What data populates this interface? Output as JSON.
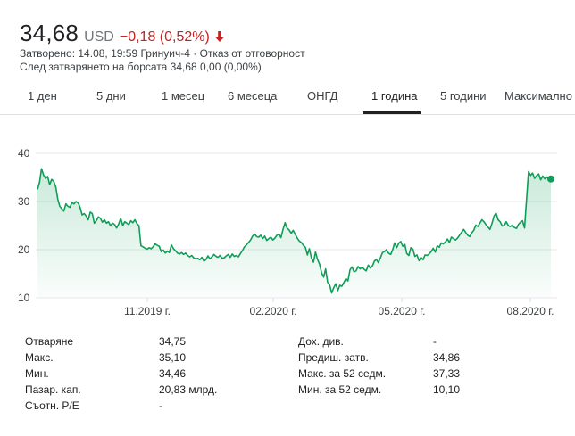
{
  "header": {
    "price": "34,68",
    "currency": "USD",
    "change": "−0,18 (0,52%)",
    "change_color": "#c5221f",
    "direction_icon": "arrow-down-icon",
    "meta_line1": "Затворено: 14.08, 19:59 Гринуич-4 · Отказ от отговорност",
    "meta_line2": "След затварянето на борсата 34,68 0,00 (0,00%)"
  },
  "tabs": [
    {
      "label": "1 ден"
    },
    {
      "label": "5 дни"
    },
    {
      "label": "1 месец"
    },
    {
      "label": "6 месеца"
    },
    {
      "label": "ОНГД"
    },
    {
      "label": "1 година",
      "active": true
    },
    {
      "label": "5 години"
    },
    {
      "label": "Максимално"
    }
  ],
  "chart_data": {
    "type": "area",
    "x_tick_labels": [
      "11.2019 г.",
      "02.2020 г.",
      "05.2020 г.",
      "08.2020 г."
    ],
    "y_ticks": [
      10,
      20,
      30,
      40
    ],
    "ylim": [
      10,
      40
    ],
    "line_color": "#0f9d58",
    "grid": true,
    "series": [
      {
        "values": [
          32.5,
          34.0,
          36.8,
          35.5,
          34.8,
          35.2,
          33.5,
          34.6,
          34.2,
          33.0,
          30.5,
          29.0,
          28.5,
          28.0,
          29.5,
          29.0,
          28.8,
          29.8,
          29.5,
          30.0,
          29.7,
          28.8,
          27.2,
          27.5,
          27.0,
          26.2,
          27.8,
          27.5,
          25.5,
          26.0,
          26.8,
          26.5,
          25.7,
          26.2,
          25.5,
          25.8,
          25.0,
          25.5,
          25.2,
          24.5,
          25.3,
          26.5,
          25.0,
          25.8,
          25.5,
          25.2,
          26.0,
          25.6,
          26.2,
          25.4,
          25.0,
          20.8,
          20.6,
          20.3,
          20.1,
          20.4,
          20.2,
          20.6,
          21.2,
          20.9,
          20.7,
          19.6,
          19.9,
          19.3,
          19.7,
          19.4,
          21.0,
          20.2,
          19.8,
          19.3,
          19.1,
          19.4,
          19.0,
          19.3,
          18.8,
          18.5,
          18.8,
          18.3,
          18.1,
          18.2,
          17.9,
          18.4,
          17.6,
          17.9,
          18.7,
          18.1,
          18.5,
          19.0,
          18.6,
          18.4,
          18.8,
          18.2,
          18.3,
          18.7,
          19.0,
          18.4,
          19.1,
          18.6,
          18.8,
          18.5,
          19.2,
          19.8,
          20.6,
          21.0,
          21.5,
          22.0,
          22.8,
          23.2,
          22.7,
          22.6,
          23.0,
          22.3,
          22.8,
          21.9,
          22.3,
          22.6,
          22.0,
          22.4,
          23.0,
          23.2,
          22.5,
          24.2,
          25.6,
          24.5,
          24.1,
          23.4,
          24.0,
          23.2,
          22.4,
          21.8,
          21.5,
          20.9,
          20.5,
          18.9,
          20.2,
          18.3,
          17.4,
          19.5,
          18.0,
          17.0,
          15.2,
          14.3,
          16.0,
          13.2,
          12.6,
          11.0,
          12.1,
          12.9,
          11.5,
          12.6,
          12.4,
          13.2,
          14.0,
          13.5,
          15.8,
          16.4,
          15.4,
          15.6,
          16.5,
          16.0,
          16.4,
          15.9,
          15.6,
          16.8,
          16.2,
          16.6,
          17.6,
          18.0,
          17.3,
          18.3,
          19.4,
          19.6,
          20.0,
          19.3,
          19.0,
          19.9,
          21.4,
          20.4,
          21.3,
          21.7,
          20.7,
          21.1,
          19.2,
          18.8,
          20.4,
          20.1,
          18.6,
          18.9,
          17.7,
          18.4,
          17.9,
          18.9,
          18.8,
          19.1,
          19.6,
          20.3,
          19.5,
          20.8,
          20.5,
          21.4,
          21.2,
          21.6,
          22.2,
          21.5,
          22.6,
          22.3,
          22.0,
          22.4,
          23.0,
          23.6,
          24.2,
          23.6,
          23.0,
          22.7,
          23.5,
          24.0,
          25.1,
          24.8,
          25.5,
          26.2,
          25.8,
          25.2,
          24.7,
          24.2,
          25.5,
          27.0,
          27.6,
          26.2,
          25.8,
          24.9,
          25.0,
          25.8,
          25.0,
          24.8,
          25.1,
          24.6,
          24.4,
          25.2,
          25.7,
          26.0,
          24.5,
          30.3,
          36.2,
          35.4,
          35.9,
          34.8,
          35.4,
          35.7,
          34.5,
          35.3,
          34.7,
          35.1,
          34.6,
          34.68
        ]
      }
    ]
  },
  "stats": {
    "col1": [
      {
        "label": "Отваряне",
        "value": "34,75"
      },
      {
        "label": "Макс.",
        "value": "35,10"
      },
      {
        "label": "Мин.",
        "value": "34,46"
      },
      {
        "label": "Пазар. кап.",
        "value": "20,83 млрд."
      },
      {
        "label": "Съотн. P/E",
        "value": "-"
      }
    ],
    "col2": [
      {
        "label": "Дох. див.",
        "value": "-"
      },
      {
        "label": "Предиш. затв.",
        "value": "34,86"
      },
      {
        "label": "Макс. за 52 седм.",
        "value": "37,33"
      },
      {
        "label": "Мин. за 52 седм.",
        "value": "10,10"
      }
    ]
  }
}
